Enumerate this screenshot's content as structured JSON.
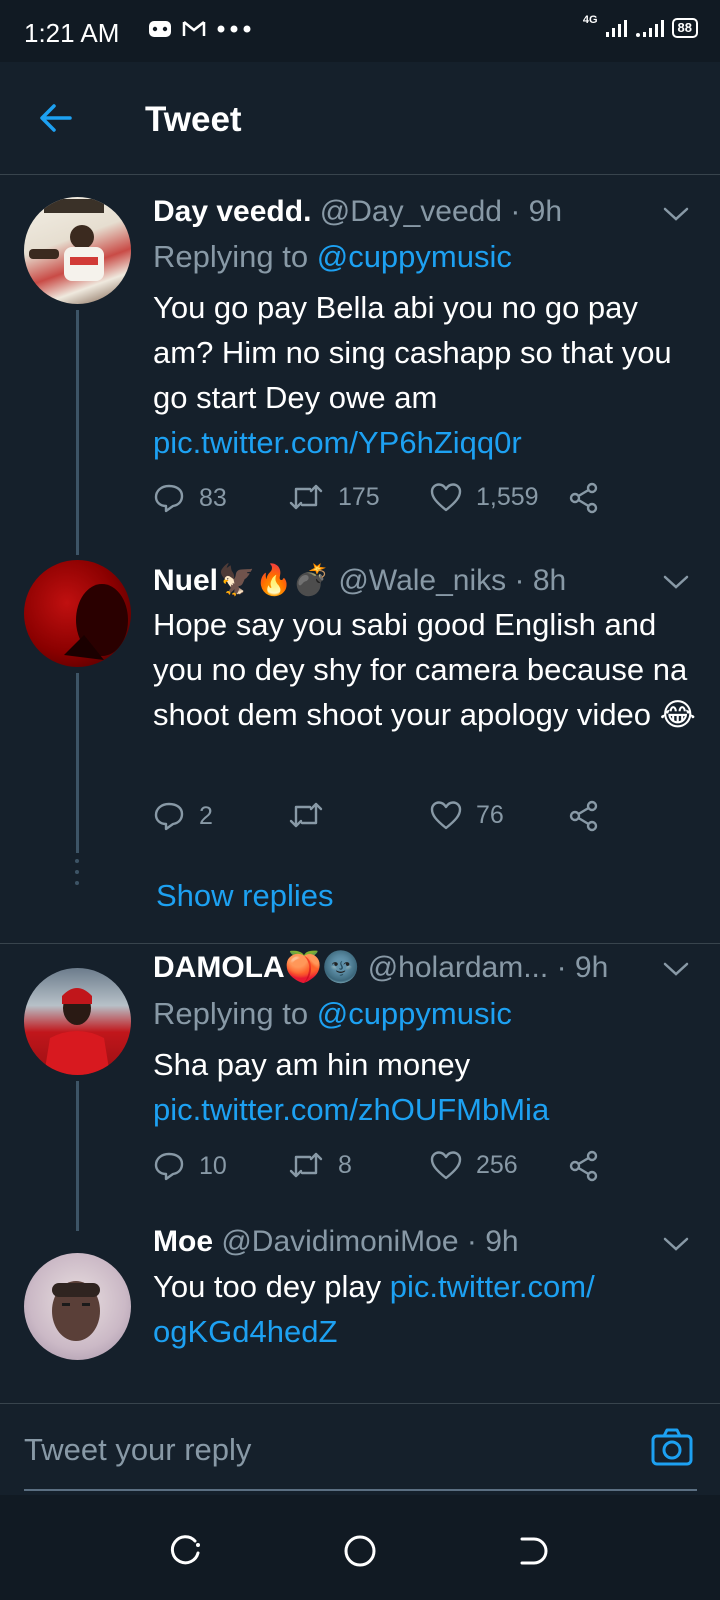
{
  "status": {
    "time": "1:21 AM",
    "network": "4G",
    "battery": "88"
  },
  "header": {
    "title": "Tweet"
  },
  "tweets": [
    {
      "name": "Day veedd.",
      "handle": "@Day_veedd",
      "time": "· 9h",
      "reply_prefix": "Replying to ",
      "reply_to": "@cuppymusic",
      "text": "You go pay Bella abi you no go pay am? Him no sing cashapp so that you go start Dey owe am",
      "link": "pic.twitter.com/YP6hZiqq0r",
      "replies": "83",
      "retweets": "175",
      "likes": "1,559"
    },
    {
      "name": "Nuel🦅🔥💣",
      "handle": "@Wale_niks",
      "time": "· 8h",
      "text": "Hope say you sabi good English and you no dey shy for camera because na shoot dem shoot your apology video 😂",
      "replies": "2",
      "retweets": "",
      "likes": "76"
    },
    {
      "name": "DAMOLA🍑🌚",
      "handle": "@holardam...",
      "time": "· 9h",
      "reply_prefix": "Replying to ",
      "reply_to": "@cuppymusic",
      "text": "Sha pay am hin money",
      "link": "pic.twitter.com/zhOUFMbMia",
      "replies": "10",
      "retweets": "8",
      "likes": "256"
    },
    {
      "name": "Moe",
      "handle": "@DavidimoniMoe",
      "time": "· 9h",
      "text": "You too dey play ",
      "link_part1": "pic.twitter.com/",
      "link_part2": "ogKGd4hedZ"
    }
  ],
  "show_replies": "Show replies",
  "reply_bar": {
    "placeholder": "Tweet your reply"
  },
  "colors": {
    "background": "#15202b",
    "accent": "#1da1f2",
    "muted": "#8899a6",
    "divider": "#38444d"
  },
  "icons": [
    "back-arrow-icon",
    "chevron-down-icon",
    "reply-icon",
    "retweet-icon",
    "like-icon",
    "share-icon",
    "camera-icon",
    "recent-apps-icon",
    "home-circle-icon",
    "back-nav-icon"
  ]
}
